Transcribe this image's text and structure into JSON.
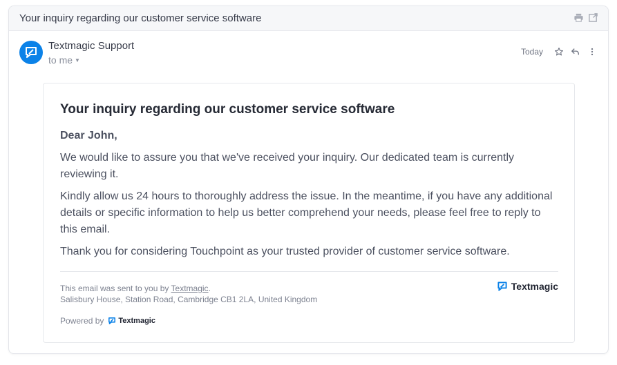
{
  "header": {
    "subject": "Your inquiry regarding our customer service software"
  },
  "message": {
    "sender": "Textmagic Support",
    "recipient": "to me",
    "date": "Today"
  },
  "email": {
    "title": "Your inquiry regarding our customer service software",
    "greeting": "Dear John,",
    "paragraph_1": "We would like to assure you that we've received your inquiry. Our dedicated team is currently reviewing it.",
    "paragraph_2": "Kindly allow us 24 hours to thoroughly address the issue. In the meantime, if you have any additional details or specific information to help us better comprehend your needs, please feel free to reply to this email.",
    "paragraph_3": "Thank you for considering Touchpoint as your trusted provider of customer service software."
  },
  "footer": {
    "sent_by_prefix": "This email was sent to you by ",
    "sent_by_link": "Textmagic",
    "sent_by_suffix": ".",
    "address": "Salisbury House, Station Road, Cambridge CB1 2LA, United Kingdom",
    "brand_name": "Textmagic",
    "powered_by": "Powered by",
    "powered_brand": "Textmagic"
  },
  "icons": {
    "print": "print-icon",
    "open_external": "open-in-new-window-icon",
    "star": "star-icon",
    "reply": "reply-icon",
    "more": "more-vertical-icon",
    "avatar": "textmagic-logo-icon"
  },
  "colors": {
    "brand_blue": "#0b82e8",
    "topbar_bg": "#f6f7f9"
  }
}
